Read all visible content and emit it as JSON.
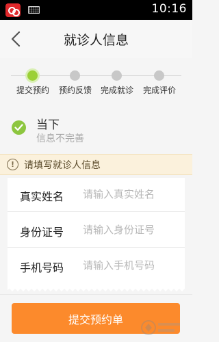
{
  "status_bar": {
    "time": "10:16",
    "icons": [
      "app-badge-icon",
      "keyboard-icon"
    ]
  },
  "header": {
    "title": "就诊人信息",
    "back_icon": "back-arrow-icon"
  },
  "steps": [
    {
      "label": "提交预约",
      "active": true
    },
    {
      "label": "预约反馈",
      "active": false
    },
    {
      "label": "完成就诊",
      "active": false
    },
    {
      "label": "完成评价",
      "active": false
    }
  ],
  "patient": {
    "name": "当下",
    "status": "信息不完善",
    "icon": "check-circle-icon"
  },
  "notice": {
    "icon": "warning-icon",
    "text": "请填写就诊人信息"
  },
  "form": {
    "fields": [
      {
        "label": "真实姓名",
        "placeholder": "请输入真实姓名",
        "value": ""
      },
      {
        "label": "身份证号",
        "placeholder": "请输入身份证号",
        "value": ""
      },
      {
        "label": "手机号码",
        "placeholder": "请输入手机号码",
        "value": ""
      }
    ]
  },
  "footer": {
    "submit_label": "提交预约单"
  },
  "colors": {
    "accent": "#fc8a2c",
    "step_active": "#9bd036",
    "check": "#8dc63f",
    "notice_bg": "#fbf1dc"
  }
}
